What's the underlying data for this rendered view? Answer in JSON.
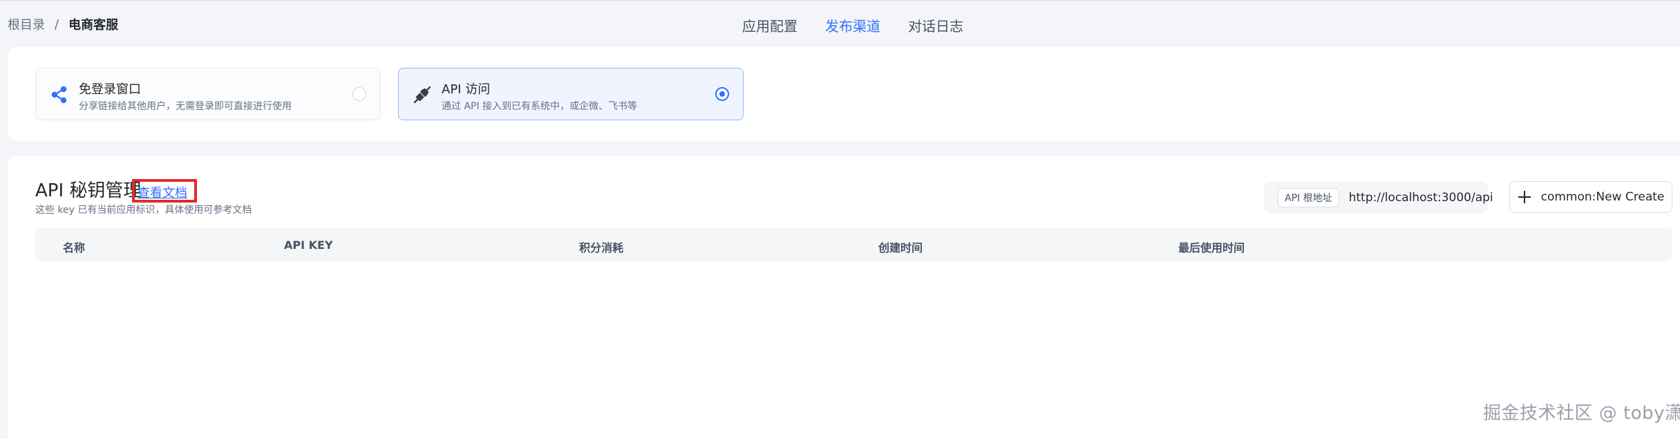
{
  "breadcrumb": {
    "root": "根目录",
    "separator": "/",
    "current": "电商客服"
  },
  "tabs": [
    {
      "label": "应用配置",
      "active": false
    },
    {
      "label": "发布渠道",
      "active": true
    },
    {
      "label": "对话日志",
      "active": false
    }
  ],
  "channels": [
    {
      "icon": "share-icon",
      "title": "免登录窗口",
      "description": "分享链接给其他用户，无需登录即可直接进行使用",
      "selected": false
    },
    {
      "icon": "api-plug-icon",
      "title": "API 访问",
      "description": "通过 API 接入到已有系统中，或企微、飞书等",
      "selected": true
    }
  ],
  "api_keys": {
    "title": "API 秘钥管理",
    "doc_link": "查看文档",
    "subtitle": "这些 key 已有当前应用标识，具体使用可参考文档",
    "base_url_label": "API 根地址",
    "base_url": "http://localhost:3000/api",
    "create_label": "common:New Create",
    "columns": [
      "名称",
      "API KEY",
      "积分消耗",
      "创建时间",
      "最后使用时间"
    ],
    "rows": []
  },
  "watermark": "掘金技术社区 @ toby潇",
  "colors": {
    "accent": "#3370ff",
    "highlight_box": "#e42a2a",
    "share_icon": "#3370ff",
    "plug_icon": "#3a3f47"
  }
}
